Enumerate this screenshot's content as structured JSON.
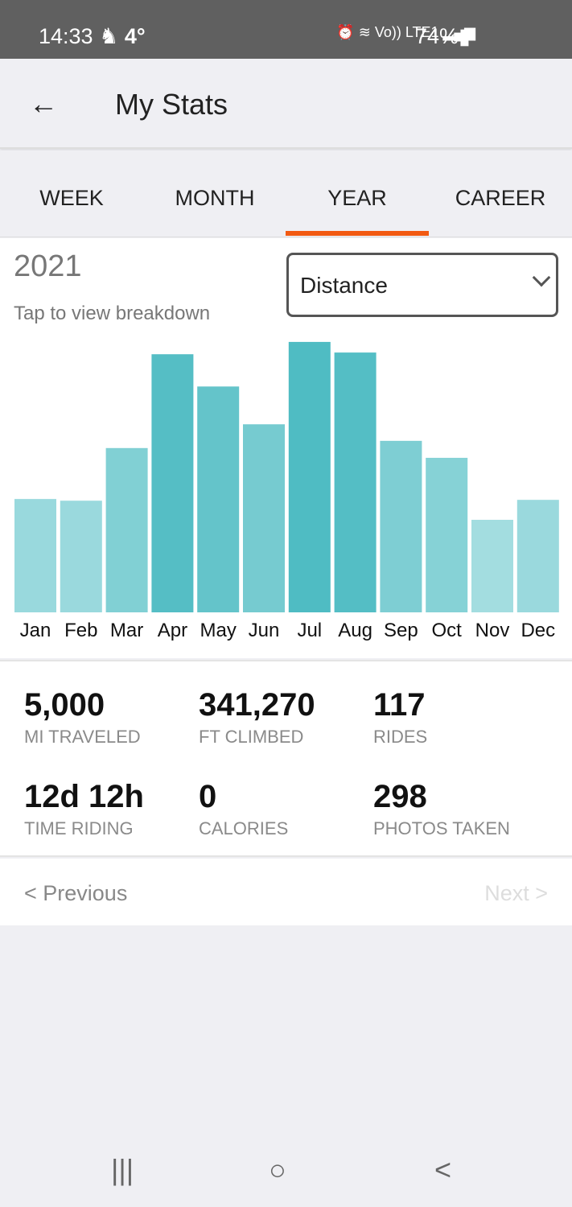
{
  "status_bar": {
    "time": "14:33",
    "weather": "4°",
    "network": "Vo)) LTE1",
    "battery": "74%"
  },
  "header": {
    "title": "My Stats",
    "back_icon": "arrow-left-icon"
  },
  "tabs": [
    {
      "label": "WEEK"
    },
    {
      "label": "MONTH"
    },
    {
      "label": "YEAR",
      "selected": true
    },
    {
      "label": "CAREER"
    }
  ],
  "accent_color": "#f25a12",
  "period": {
    "year": "2021",
    "hint": "Tap to view breakdown",
    "metric": "Distance"
  },
  "chart_data": {
    "type": "bar",
    "categories": [
      "Jan",
      "Feb",
      "Mar",
      "Apr",
      "May",
      "Jun",
      "Jul",
      "Aug",
      "Sep",
      "Oct",
      "Nov",
      "Dec"
    ],
    "values": [
      267,
      263,
      387,
      608,
      532,
      443,
      637,
      612,
      404,
      364,
      218,
      265
    ],
    "ylabel": "",
    "xlabel": "",
    "grid": false,
    "colors": {
      "low": "#a3dde0",
      "high": "#4fbcc3"
    }
  },
  "stats": [
    {
      "value": "5,000",
      "label": "MI TRAVELED"
    },
    {
      "value": "341,270",
      "label": "FT CLIMBED"
    },
    {
      "value": "117",
      "label": "RIDES"
    },
    {
      "value": "12d 12h",
      "label": "TIME RIDING"
    },
    {
      "value": "0",
      "label": "CALORIES"
    },
    {
      "value": "298",
      "label": "PHOTOS TAKEN"
    }
  ],
  "pager": {
    "previous": "< Previous",
    "next": "Next >"
  },
  "nav_bar": {
    "recents": "|||",
    "home": "○",
    "back": "<"
  }
}
